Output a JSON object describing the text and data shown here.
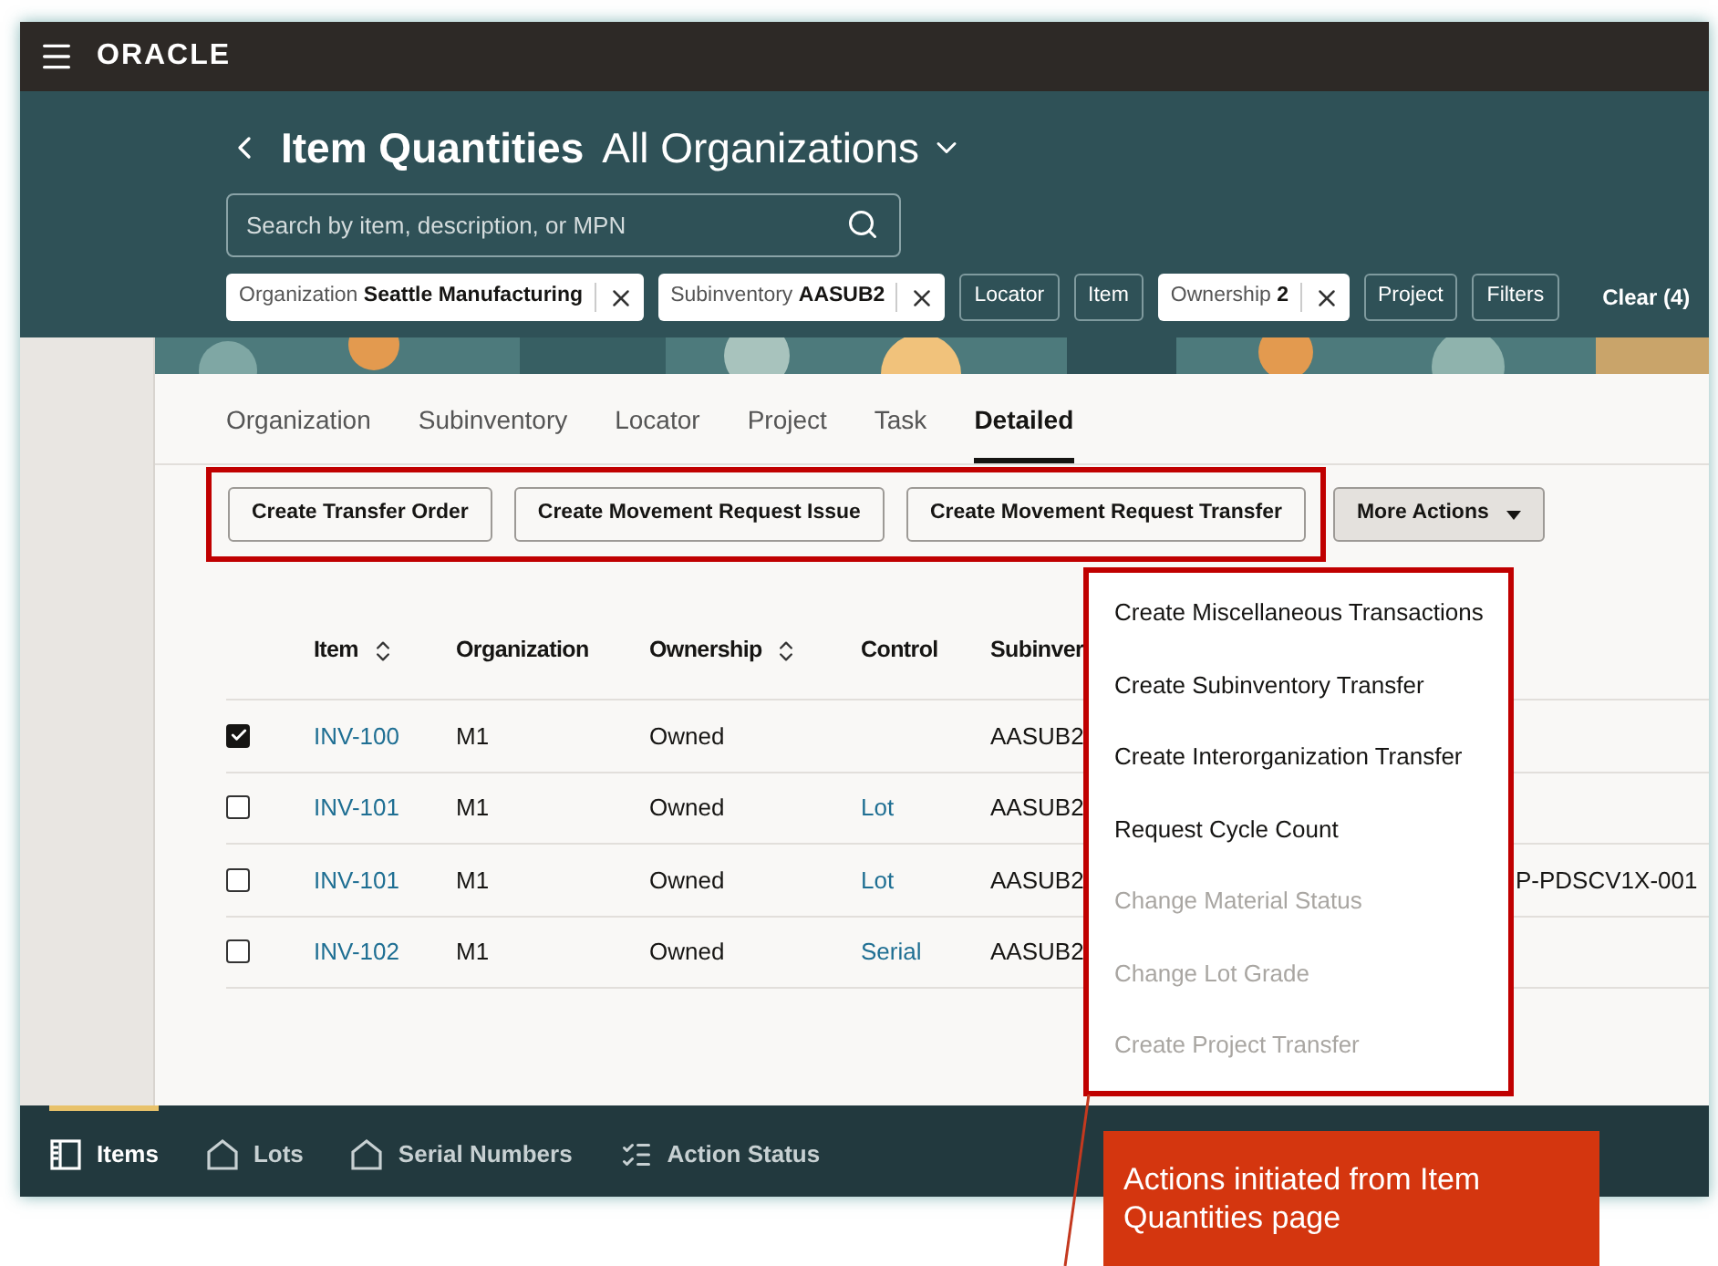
{
  "top_bar": {
    "logo": "ORACLE"
  },
  "header": {
    "title": "Item Quantities",
    "subtitle": "All Organizations",
    "search": {
      "placeholder": "Search by item, description, or MPN"
    },
    "filters": [
      {
        "kind": "applied",
        "label": "Organization",
        "value": "Seattle Manufacturing"
      },
      {
        "kind": "applied",
        "label": "Subinventory",
        "value": "AASUB2"
      },
      {
        "kind": "plain",
        "label": "Locator"
      },
      {
        "kind": "plain",
        "label": "Item"
      },
      {
        "kind": "applied",
        "label": "Ownership",
        "value": "2"
      },
      {
        "kind": "plain",
        "label": "Project"
      },
      {
        "kind": "plain",
        "label": "Filters"
      }
    ],
    "clear": "Clear (4)"
  },
  "tabs": [
    {
      "label": "Organization",
      "selected": false
    },
    {
      "label": "Subinventory",
      "selected": false
    },
    {
      "label": "Locator",
      "selected": false
    },
    {
      "label": "Project",
      "selected": false
    },
    {
      "label": "Task",
      "selected": false
    },
    {
      "label": "Detailed",
      "selected": true
    }
  ],
  "actions": {
    "buttons": [
      "Create Transfer Order",
      "Create Movement Request Issue",
      "Create Movement Request Transfer"
    ],
    "more": "More Actions"
  },
  "table": {
    "columns": [
      {
        "label": "Item",
        "sortable": true
      },
      {
        "label": "Organization",
        "sortable": false
      },
      {
        "label": "Ownership",
        "sortable": true
      },
      {
        "label": "Control",
        "sortable": false
      },
      {
        "label": "Subinver"
      }
    ],
    "rows": [
      {
        "checked": true,
        "item": "INV-100",
        "organization": "M1",
        "ownership": "Owned",
        "subinventory": "AASUB2"
      },
      {
        "checked": false,
        "item": "INV-101",
        "organization": "M1",
        "ownership": "Owned",
        "control": "Lot",
        "subinventory": "AASUB2"
      },
      {
        "checked": false,
        "item": "INV-101",
        "organization": "M1",
        "ownership": "Owned",
        "control": "Lot",
        "subinventory": "AASUB2",
        "column_6": "P-PDSCV1X-001"
      },
      {
        "checked": false,
        "item": "INV-102",
        "organization": "M1",
        "ownership": "Owned",
        "control": "Serial",
        "subinventory": "AASUB2"
      }
    ]
  },
  "menu": {
    "items": [
      {
        "label": "Create Miscellaneous Transactions",
        "disabled": false
      },
      {
        "label": "Create Subinventory Transfer",
        "disabled": false
      },
      {
        "label": "Create Interorganization Transfer",
        "disabled": false
      },
      {
        "label": "Request Cycle Count",
        "disabled": false
      },
      {
        "label": "Change Material Status",
        "disabled": true
      },
      {
        "label": "Change Lot Grade",
        "disabled": true
      },
      {
        "label": "Create Project Transfer",
        "disabled": true
      }
    ]
  },
  "bottom_nav": [
    {
      "kind": "items",
      "label": "Items",
      "selected": true
    },
    {
      "kind": "lots",
      "label": "Lots",
      "selected": false
    },
    {
      "kind": "serials",
      "label": "Serial Numbers",
      "selected": false
    },
    {
      "kind": "status",
      "label": "Action Status",
      "selected": false
    }
  ],
  "callout": {
    "text": "Actions initiated from Item Quantities page"
  }
}
